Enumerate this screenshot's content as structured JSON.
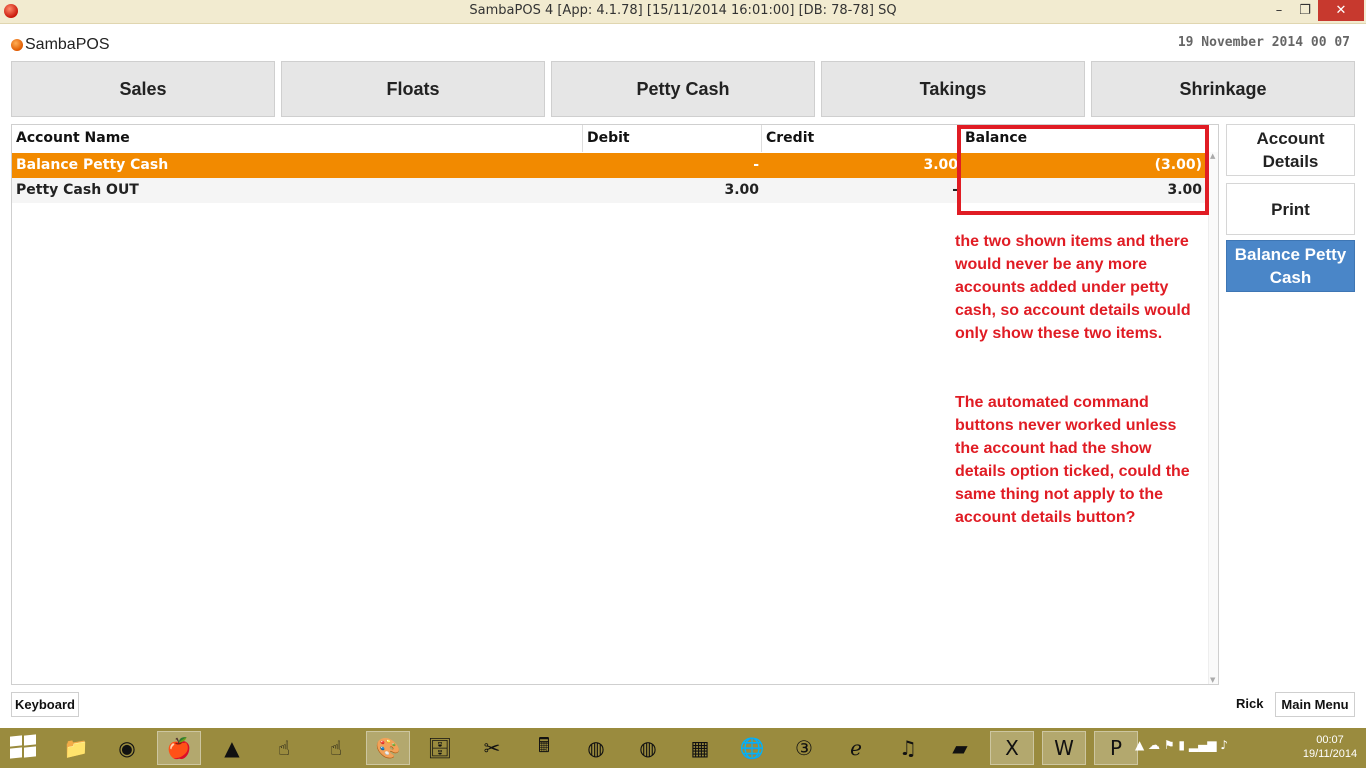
{
  "window": {
    "title": "SambaPOS 4 [App: 4.1.78] [15/11/2014 16:01:00] [DB: 78-78] SQ",
    "minimize_glyph": "–",
    "maximize_glyph": "❐",
    "close_glyph": "✕"
  },
  "header": {
    "logo_text": "SambaPOS",
    "datetime": "19 November 2014 00 07"
  },
  "tabs": [
    {
      "label": "Sales"
    },
    {
      "label": "Floats"
    },
    {
      "label": "Petty Cash"
    },
    {
      "label": "Takings"
    },
    {
      "label": "Shrinkage"
    }
  ],
  "grid": {
    "columns": [
      "Account Name",
      "Debit",
      "Credit",
      "Balance"
    ],
    "rows": [
      {
        "name": "Balance Petty Cash",
        "debit": "-",
        "credit": "3.00",
        "balance": "(3.00)",
        "selected": true
      },
      {
        "name": "Petty Cash OUT",
        "debit": "3.00",
        "credit": "-",
        "balance": "3.00",
        "selected": false
      }
    ]
  },
  "annotation": {
    "paragraph1": "the two shown items and there would never be any more accounts added under petty cash, so account details would only show these two items.",
    "paragraph2": "The automated command buttons never worked unless the account had the show details option ticked, could the same thing not apply to the account details button?",
    "color": "#e01c24"
  },
  "side_buttons": {
    "account_details": "Account Details",
    "print": "Print",
    "balance_petty_cash": "Balance Petty Cash"
  },
  "footer": {
    "keyboard": "Keyboard",
    "user": "Rick",
    "main_menu": "Main Menu"
  },
  "taskbar": {
    "icons": [
      "file-explorer-icon",
      "chrome-icon",
      "sambapos-icon",
      "app-icon",
      "hand-icon",
      "hand-icon",
      "paint-icon",
      "archive-icon",
      "tool-icon",
      "register-icon",
      "database-icon",
      "database-icon",
      "calculator-icon",
      "globe-icon",
      "three-icon",
      "ie-icon",
      "itunes-icon",
      "notes-icon",
      "excel-icon",
      "word-icon",
      "publisher-icon"
    ],
    "clock_time": "00:07",
    "clock_date": "19/11/2014"
  },
  "colors": {
    "selected_row": "#f28a00",
    "blue_button": "#4a86c8",
    "taskbar": "#9a8b3e"
  }
}
